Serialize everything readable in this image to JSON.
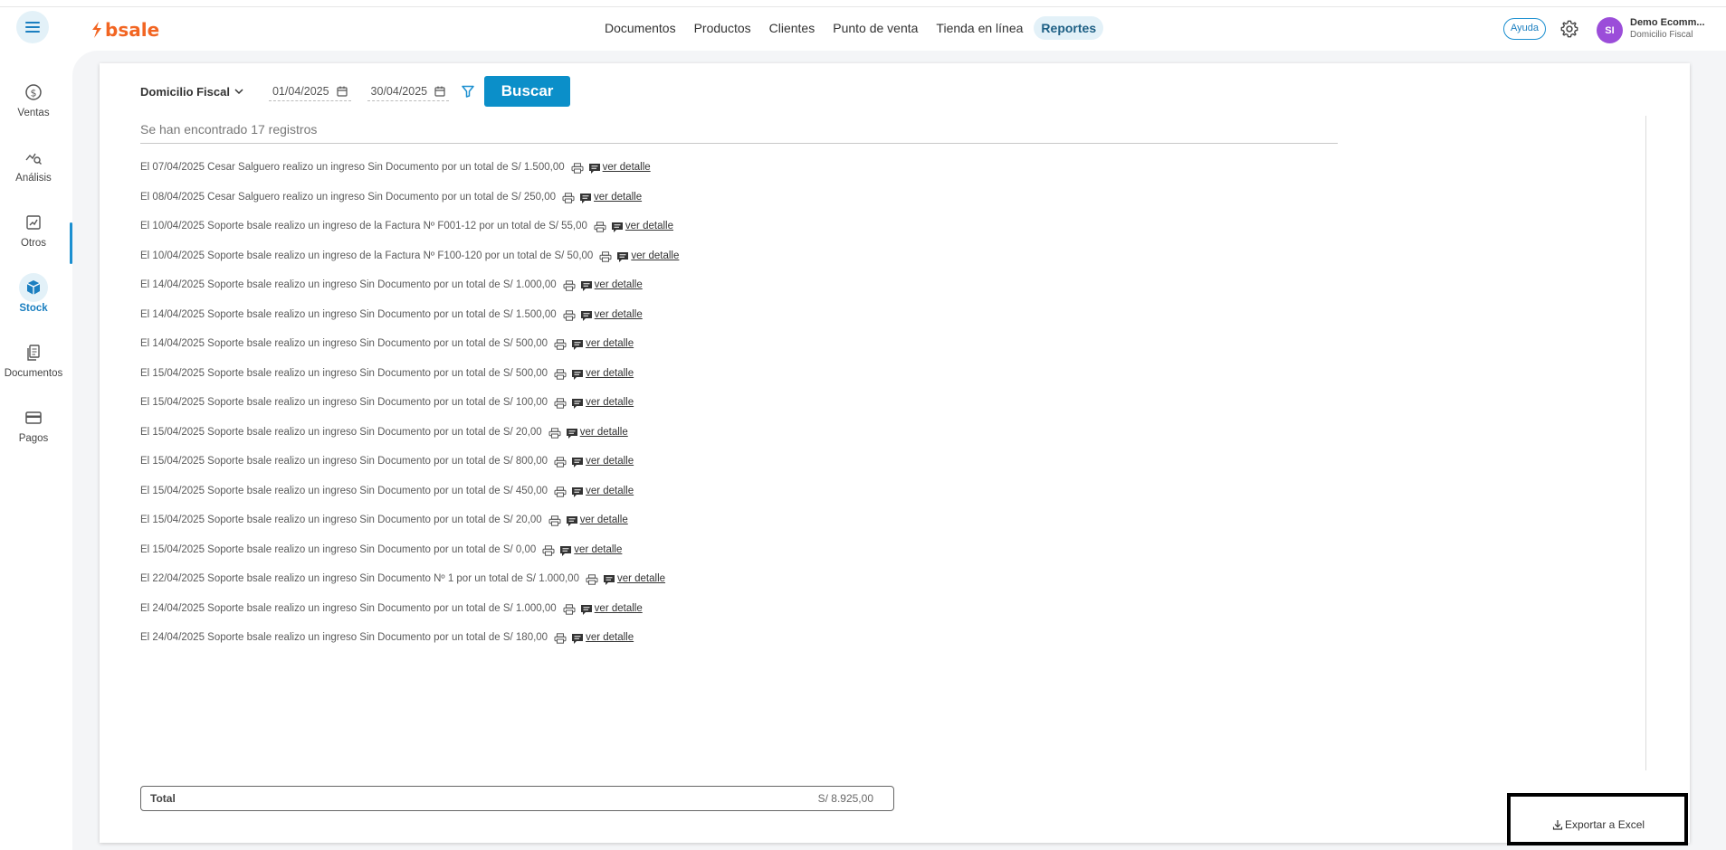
{
  "header": {
    "logo_text": "bsale",
    "nav": [
      "Documentos",
      "Productos",
      "Clientes",
      "Punto de venta",
      "Tienda en línea",
      "Reportes"
    ],
    "active_nav": "Reportes",
    "help_label": "Ayuda",
    "avatar_initials": "SI",
    "user_name": "Demo Ecomm...",
    "user_sub": "Domicilio Fiscal"
  },
  "sidebar": {
    "items": [
      {
        "label": "Ventas",
        "icon": "dollar-icon"
      },
      {
        "label": "Análisis",
        "icon": "analysis-icon"
      },
      {
        "label": "Otros",
        "icon": "chart-icon"
      },
      {
        "label": "Stock",
        "icon": "box-icon"
      },
      {
        "label": "Documentos",
        "icon": "document-icon"
      },
      {
        "label": "Pagos",
        "icon": "card-icon"
      }
    ],
    "active": "Stock"
  },
  "filters": {
    "domicilio": "Domicilio Fiscal",
    "date_from": "01/04/2025",
    "date_to": "30/04/2025",
    "search_label": "Buscar"
  },
  "results": {
    "found_text": "Se han encontrado 17 registros",
    "detail_label": "ver detalle",
    "rows": [
      "El 07/04/2025 Cesar Salguero realizo un ingreso Sin Documento por un total de S/ 1.500,00",
      "El 08/04/2025 Cesar Salguero realizo un ingreso Sin Documento por un total de S/ 250,00",
      "El 10/04/2025 Soporte bsale realizo un ingreso de la Factura Nº F001-12 por un total de S/ 55,00",
      "El 10/04/2025 Soporte bsale realizo un ingreso de la Factura Nº F100-120 por un total de S/ 50,00",
      "El 14/04/2025 Soporte bsale realizo un ingreso Sin Documento por un total de S/ 1.000,00",
      "El 14/04/2025 Soporte bsale realizo un ingreso Sin Documento por un total de S/ 1.500,00",
      "El 14/04/2025 Soporte bsale realizo un ingreso Sin Documento por un total de S/ 500,00",
      "El 15/04/2025 Soporte bsale realizo un ingreso Sin Documento por un total de S/ 500,00",
      "El 15/04/2025 Soporte bsale realizo un ingreso Sin Documento por un total de S/ 100,00",
      "El 15/04/2025 Soporte bsale realizo un ingreso Sin Documento por un total de S/ 20,00",
      "El 15/04/2025 Soporte bsale realizo un ingreso Sin Documento por un total de S/ 800,00",
      "El 15/04/2025 Soporte bsale realizo un ingreso Sin Documento por un total de S/ 450,00",
      "El 15/04/2025 Soporte bsale realizo un ingreso Sin Documento por un total de S/ 20,00",
      "El 15/04/2025 Soporte bsale realizo un ingreso Sin Documento por un total de S/ 0,00",
      "El 22/04/2025 Soporte bsale realizo un ingreso Sin Documento Nº 1 por un total de S/ 1.000,00",
      "El 24/04/2025 Soporte bsale realizo un ingreso Sin Documento por un total de S/ 1.000,00",
      "El 24/04/2025 Soporte bsale realizo un ingreso Sin Documento por un total de S/ 180,00"
    ]
  },
  "total": {
    "label": "Total",
    "value": "S/ 8.925,00"
  },
  "export_label": "Exportar a Excel",
  "colors": {
    "accent": "#0b8fc9",
    "brand": "#f26522",
    "avatar": "#9b4dd9",
    "active_bg": "#e3f1f8"
  }
}
